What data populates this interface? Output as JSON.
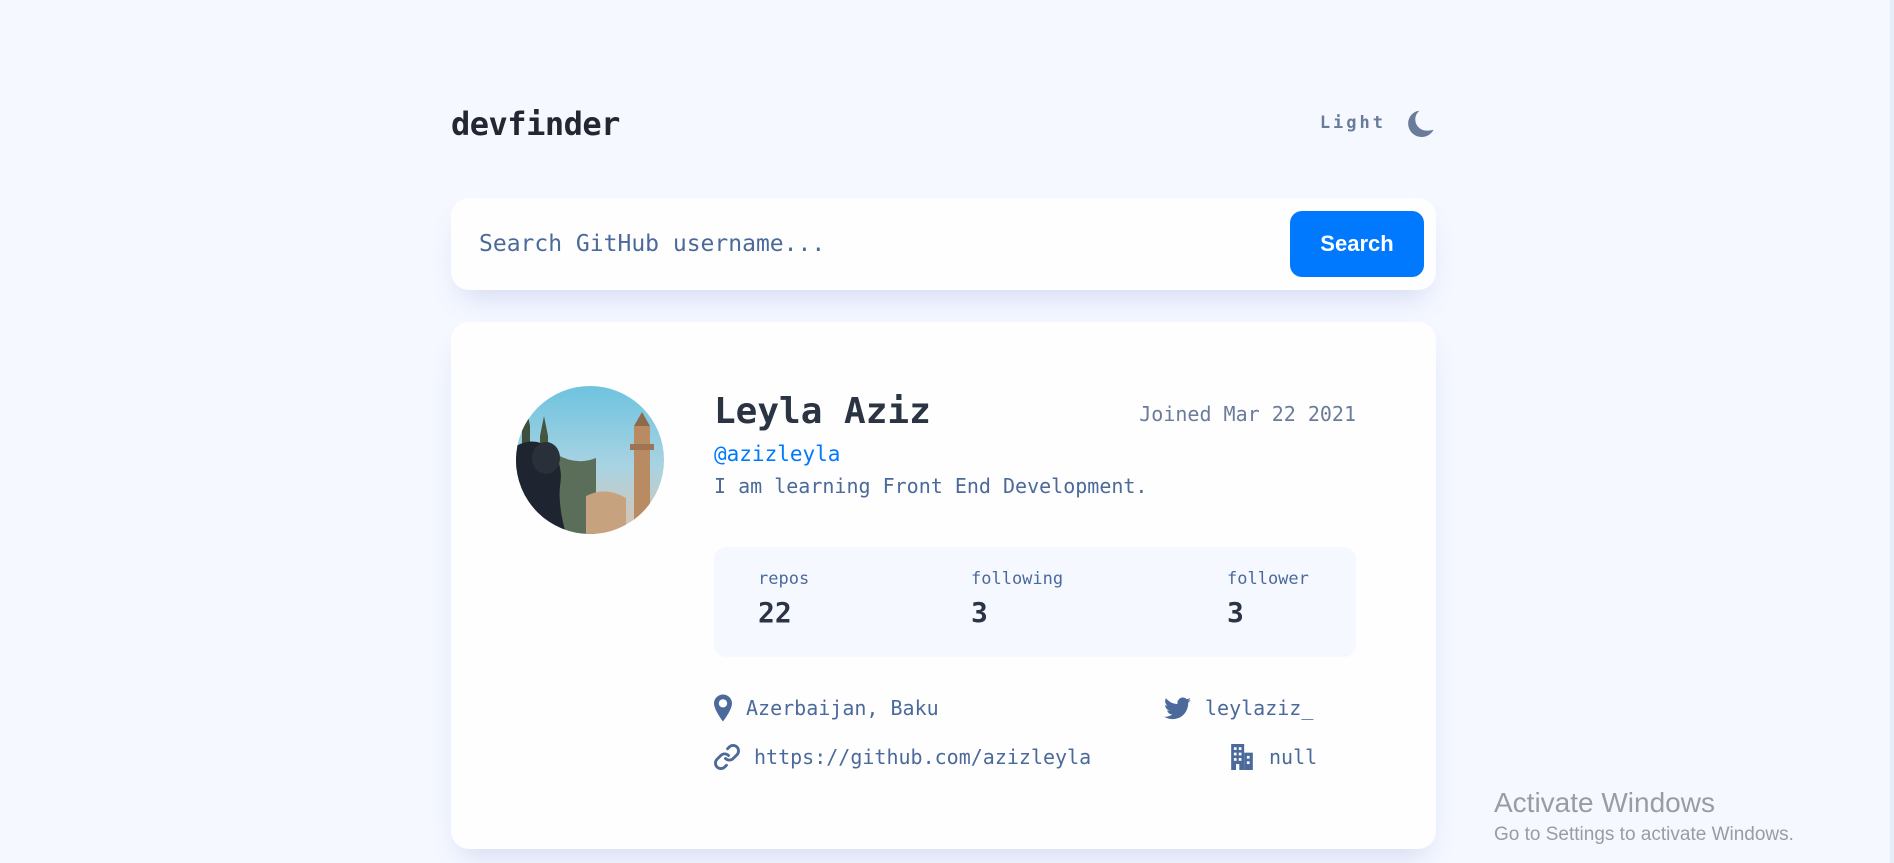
{
  "header": {
    "logo": "devfinder",
    "theme_label": "Light",
    "theme_icon": "moon-icon"
  },
  "search": {
    "placeholder": "Search GitHub username...",
    "value": "",
    "button_label": "Search"
  },
  "profile": {
    "name": "Leyla Aziz",
    "joined": "Joined Mar 22 2021",
    "username": "@azizleyla",
    "bio": "I am learning Front End Development.",
    "stats": {
      "repos_label": "repos",
      "repos_value": "22",
      "following_label": "following",
      "following_value": "3",
      "followers_label": "follower",
      "followers_value": "3"
    },
    "links": {
      "location": "Azerbaijan, Baku",
      "twitter": "leylaziz_",
      "website": "https://github.com/azizleyla",
      "company": "null"
    }
  },
  "colors": {
    "accent": "#0079FF",
    "background": "#F5F8FF",
    "card": "#FEFEFE",
    "text_muted": "#4B6A9B",
    "text_dark": "#2B3442"
  },
  "watermark": {
    "title": "Activate Windows",
    "subtitle": "Go to Settings to activate Windows."
  }
}
